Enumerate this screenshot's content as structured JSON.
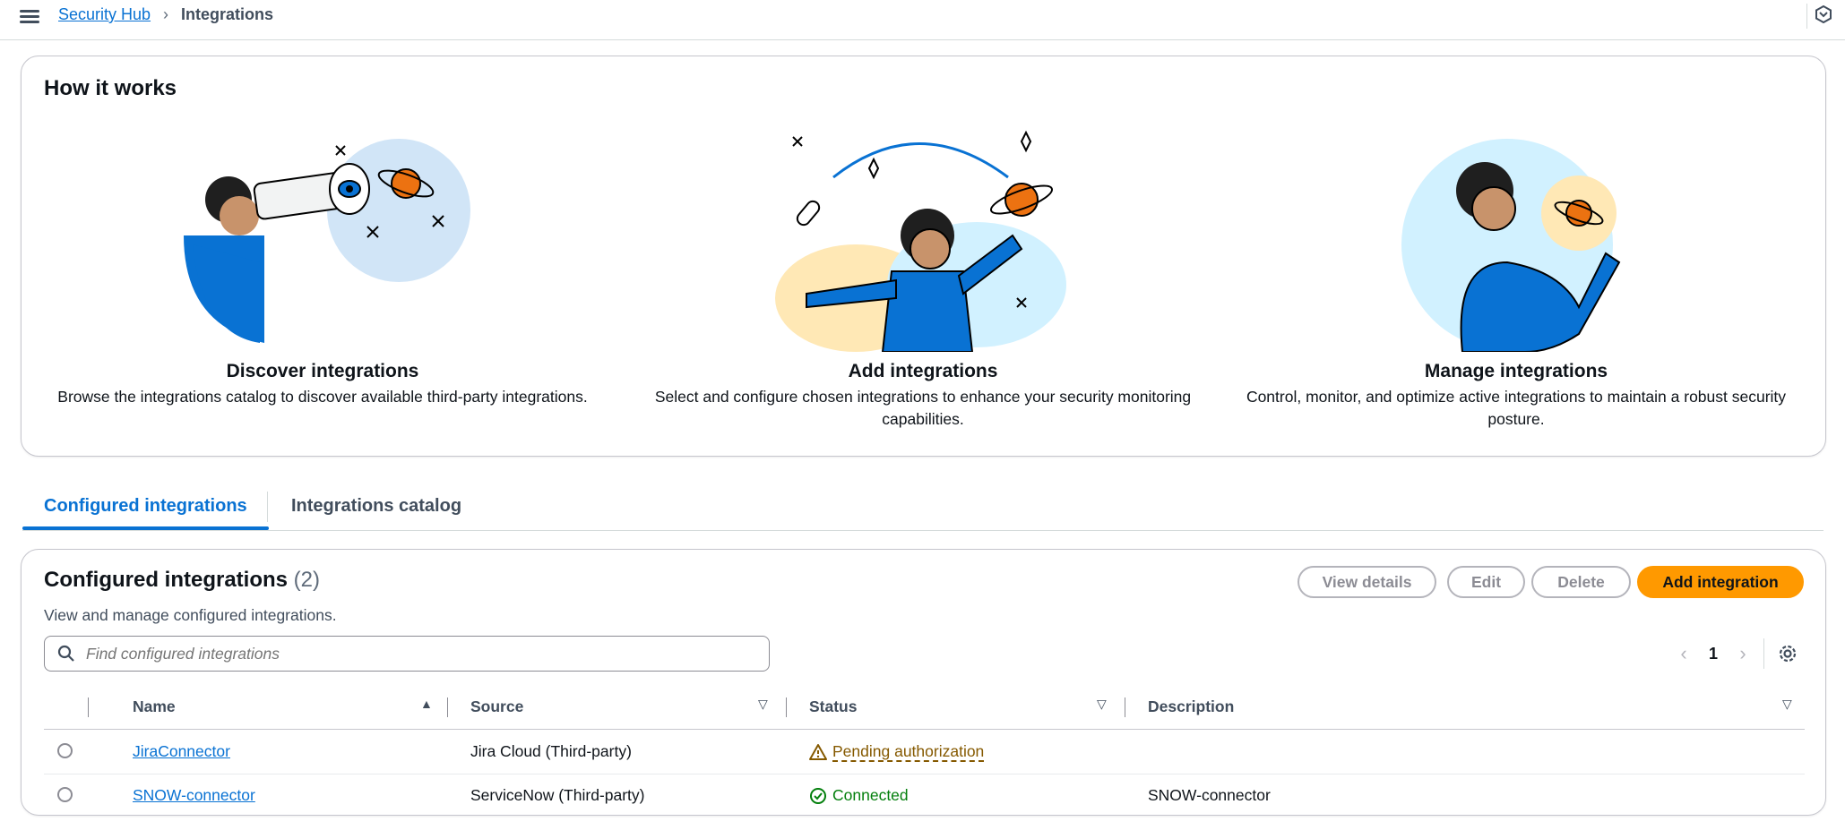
{
  "breadcrumb": {
    "parent": "Security Hub",
    "current": "Integrations"
  },
  "how_it_works": {
    "title": "How it works",
    "steps": [
      {
        "title": "Discover integrations",
        "description": "Browse the integrations catalog to discover available third-party integrations."
      },
      {
        "title": "Add integrations",
        "description": "Select and configure chosen integrations to enhance your security monitoring capabilities."
      },
      {
        "title": "Manage integrations",
        "description": "Control, monitor, and optimize active integrations to maintain a robust security posture."
      }
    ]
  },
  "tabs": [
    {
      "label": "Configured integrations",
      "active": true
    },
    {
      "label": "Integrations catalog",
      "active": false
    }
  ],
  "table": {
    "title": "Configured integrations",
    "count": "(2)",
    "description": "View and manage configured integrations.",
    "buttons": {
      "view": "View details",
      "edit": "Edit",
      "delete": "Delete",
      "add": "Add integration"
    },
    "search_placeholder": "Find configured integrations",
    "page": "1",
    "columns": {
      "name": "Name",
      "source": "Source",
      "status": "Status",
      "description": "Description"
    },
    "rows": [
      {
        "name": "JiraConnector",
        "source": "Jira Cloud (Third-party)",
        "status": "Pending authorization",
        "description": ""
      },
      {
        "name": "SNOW-connector",
        "source": "ServiceNow (Third-party)",
        "status": "Connected",
        "description": "SNOW-connector"
      }
    ]
  },
  "colors": {
    "accent": "#0972d3",
    "primary_button": "#ff9900",
    "warning": "#855900",
    "success": "#037f0c"
  }
}
